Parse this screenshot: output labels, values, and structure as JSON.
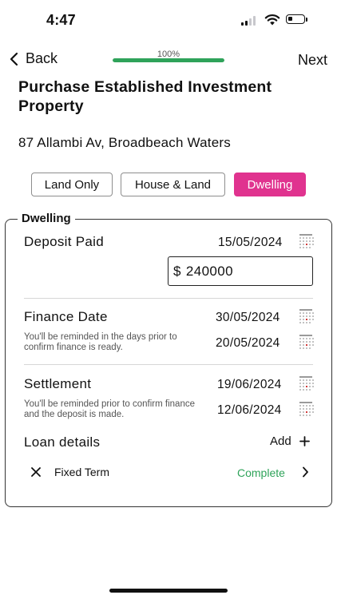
{
  "status_bar": {
    "time": "4:47"
  },
  "nav": {
    "back_label": "Back",
    "next_label": "Next",
    "progress_text": "100%",
    "progress_value": 1.0
  },
  "page": {
    "title": "Purchase Established Investment Property",
    "address": "87 Allambi Av, Broadbeach Waters"
  },
  "property_type": {
    "options": [
      "Land Only",
      "House & Land",
      "Dwelling"
    ],
    "selected": "Dwelling"
  },
  "section": {
    "legend": "Dwelling",
    "deposit": {
      "label": "Deposit Paid",
      "date": "15/05/2024",
      "currency": "$",
      "amount": "240000"
    },
    "finance": {
      "label": "Finance Date",
      "date": "30/05/2024",
      "hint": "You'll be reminded in the days prior to confirm finance is ready.",
      "reminder_date": "20/05/2024"
    },
    "settlement": {
      "label": "Settlement",
      "date": "19/06/2024",
      "hint": "You'll be reminded prior to confirm finance and the deposit is made.",
      "reminder_date": "12/06/2024"
    },
    "loan": {
      "label": "Loan details",
      "add_label": "Add",
      "items": [
        {
          "name": "Fixed Term",
          "status": "Complete"
        }
      ]
    }
  },
  "colors": {
    "accent_pink": "#e0338f",
    "success_green": "#2fa35a"
  },
  "icons": [
    "chevron-left-icon",
    "calendar-icon",
    "plus-icon",
    "close-icon",
    "chevron-right-icon"
  ]
}
